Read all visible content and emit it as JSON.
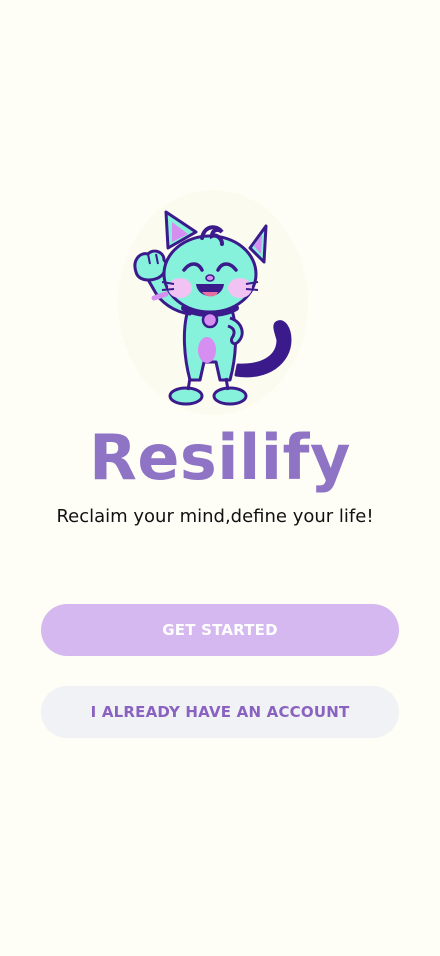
{
  "app": {
    "title": "Resilify",
    "tagline": "Reclaim your mind,define your life!"
  },
  "buttons": {
    "get_started": "GET STARTED",
    "have_account": "I ALREADY HAVE AN ACCOUNT"
  },
  "colors": {
    "background": "#fefef7",
    "title": "#8f74c6",
    "primary_button": "#d5b8f0",
    "secondary_button": "#f1f2f5",
    "secondary_button_text": "#8a62c0",
    "mascot_body": "#86f2dc",
    "mascot_outline": "#3b1a8c",
    "mascot_accent": "#d68ff0"
  },
  "icons": {
    "mascot": "waving-cat-icon"
  }
}
